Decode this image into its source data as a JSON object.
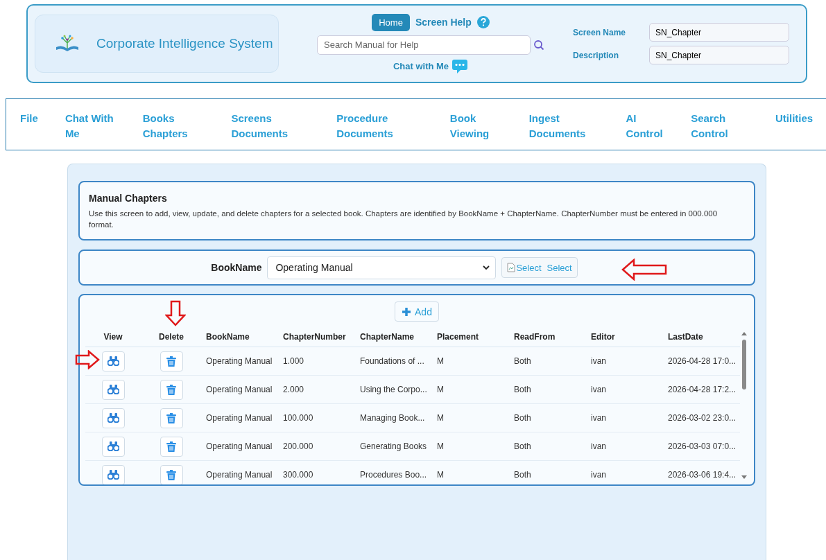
{
  "header": {
    "title": "Corporate Intelligence System",
    "home_button": "Home",
    "screen_help": "Screen Help",
    "search": {
      "placeholder": "Search Manual for Help"
    },
    "chat": "Chat with Me",
    "fields": [
      {
        "label": "Screen Name",
        "value": "SN_Chapter"
      },
      {
        "label": "Description",
        "value": "SN_Chapter"
      }
    ]
  },
  "menu": [
    "File",
    "Chat With Me",
    "Books Chapters",
    "Screens Documents",
    "Procedure Documents",
    "Book Viewing",
    "Ingest Documents",
    "AI Control",
    "Search Control",
    "Utilities"
  ],
  "intro": {
    "title": "Manual Chapters",
    "text": "Use this screen to add, view, update, and delete chapters for a selected book. Chapters are identified by BookName + ChapterName. ChapterNumber must be entered in 000.000 format."
  },
  "book_select": {
    "label": "BookName",
    "value": "Operating Manual",
    "image_alt": "Select",
    "button": "Select"
  },
  "table": {
    "add_button": "Add",
    "action_columns": [
      "View",
      "Delete"
    ],
    "columns": [
      "BookName",
      "ChapterNumber",
      "ChapterName",
      "Placement",
      "ReadFrom",
      "Editor",
      "LastDate"
    ],
    "rows": [
      [
        "Operating Manual",
        "1.000",
        "Foundations of ...",
        "M",
        "Both",
        "ivan",
        "2026-04-28 17:0..."
      ],
      [
        "Operating Manual",
        "2.000",
        "Using the Corpo...",
        "M",
        "Both",
        "ivan",
        "2026-04-28 17:2..."
      ],
      [
        "Operating Manual",
        "100.000",
        "Managing Book...",
        "M",
        "Both",
        "ivan",
        "2026-03-02 23:0..."
      ],
      [
        "Operating Manual",
        "200.000",
        "Generating Books",
        "M",
        "Both",
        "ivan",
        "2026-03-03 07:0..."
      ],
      [
        "Operating Manual",
        "300.000",
        "Procedures Boo...",
        "M",
        "Both",
        "ivan",
        "2026-03-06 19:4..."
      ]
    ]
  }
}
